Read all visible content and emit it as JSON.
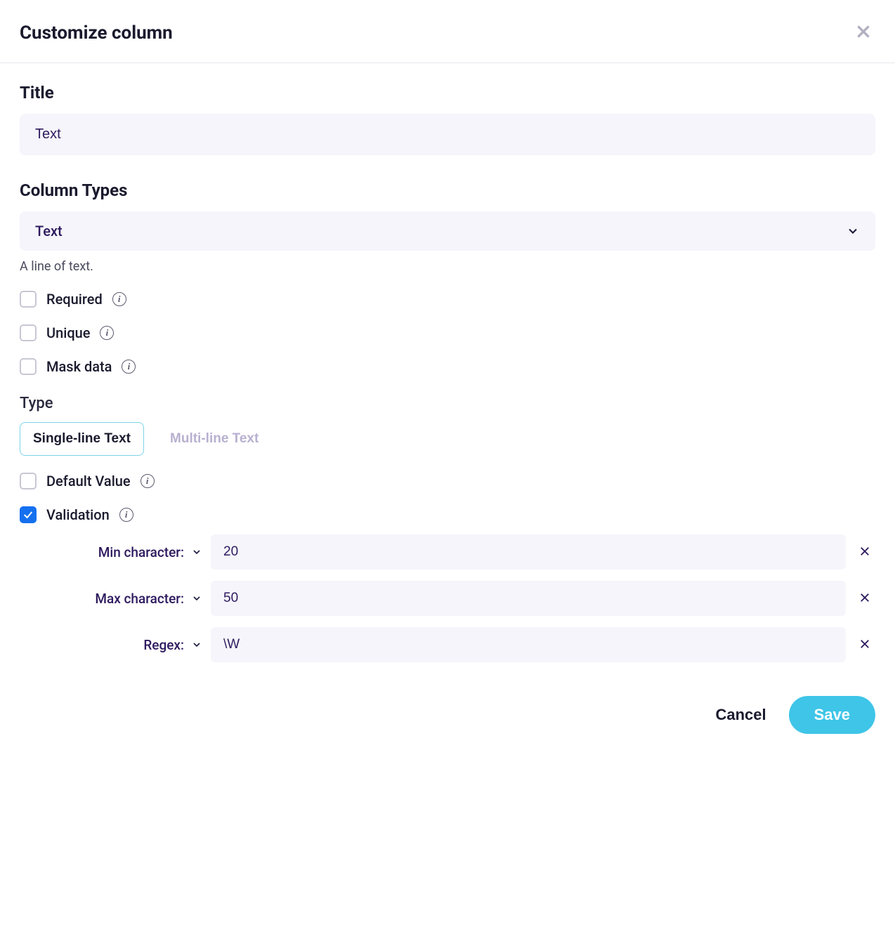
{
  "header": {
    "title": "Customize column"
  },
  "title_section": {
    "label": "Title",
    "value": "Text"
  },
  "column_types": {
    "label": "Column Types",
    "selected": "Text",
    "help": "A line of text."
  },
  "options": {
    "required": {
      "label": "Required",
      "checked": false
    },
    "unique": {
      "label": "Unique",
      "checked": false
    },
    "mask_data": {
      "label": "Mask data",
      "checked": false
    }
  },
  "type_section": {
    "label": "Type",
    "tabs": {
      "single": "Single-line Text",
      "multi": "Multi-line Text"
    }
  },
  "default_value": {
    "label": "Default Value",
    "checked": false
  },
  "validation": {
    "label": "Validation",
    "checked": true,
    "rows": {
      "min": {
        "label": "Min character:",
        "value": "20"
      },
      "max": {
        "label": "Max character:",
        "value": "50"
      },
      "regex": {
        "label": "Regex:",
        "value": "\\W"
      }
    }
  },
  "footer": {
    "cancel": "Cancel",
    "save": "Save"
  }
}
